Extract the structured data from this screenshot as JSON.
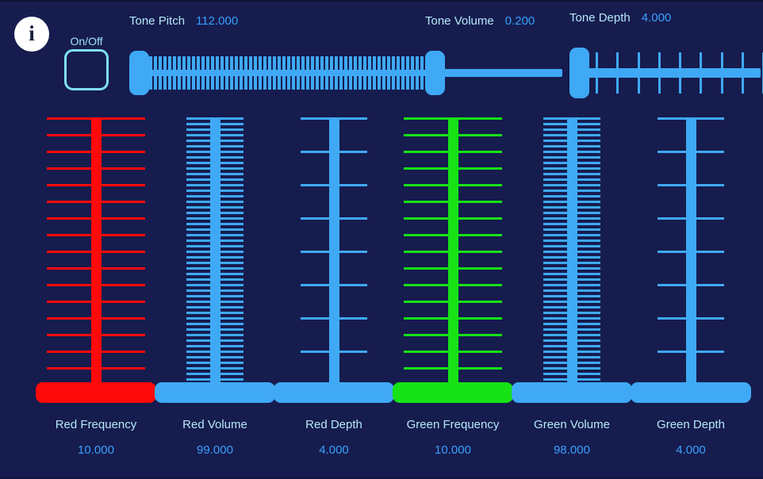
{
  "window": {
    "background_color": "#161c4e",
    "accent_color": "#3fa9f5",
    "label_color": "#b6e9f8",
    "value_color": "#3aa0ff"
  },
  "info_button": {
    "icon": "info-icon",
    "glyph": "i"
  },
  "onoff": {
    "label": "On/Off",
    "checked": false
  },
  "top_sliders": [
    {
      "id": "tone-pitch",
      "label": "Tone Pitch",
      "value": "112.000",
      "numeric": 112.0,
      "tick_style": "dense",
      "color": "#3fa9f5"
    },
    {
      "id": "tone-volume",
      "label": "Tone Volume",
      "value": "0.200",
      "numeric": 0.2,
      "tick_style": "none",
      "color": "#3fa9f5"
    },
    {
      "id": "tone-depth",
      "label": "Tone Depth",
      "value": "4.000",
      "numeric": 4.0,
      "tick_style": "sparse",
      "tick_count": 9,
      "color": "#3fa9f5"
    }
  ],
  "vertical_sliders": [
    {
      "id": "red-frequency",
      "label": "Red Frequency",
      "value": "10.000",
      "numeric": 10.0,
      "color": "#ff0a0a",
      "tick_count": 17,
      "tick_style": "medium",
      "tick_half_width": 62,
      "stem_width": 13
    },
    {
      "id": "red-volume",
      "label": "Red Volume",
      "value": "99.000",
      "numeric": 99.0,
      "color": "#3fa9f5",
      "tick_count": 99,
      "tick_style": "dense",
      "tick_half_width": 36,
      "stem_width": 13
    },
    {
      "id": "red-depth",
      "label": "Red Depth",
      "value": "4.000",
      "numeric": 4.0,
      "color": "#3fa9f5",
      "tick_count": 9,
      "tick_style": "sparse",
      "tick_half_width": 42,
      "stem_width": 13
    },
    {
      "id": "green-frequency",
      "label": "Green Frequency",
      "value": "10.000",
      "numeric": 10.0,
      "color": "#16e216",
      "tick_count": 17,
      "tick_style": "medium",
      "tick_half_width": 62,
      "stem_width": 13
    },
    {
      "id": "green-volume",
      "label": "Green Volume",
      "value": "98.000",
      "numeric": 98.0,
      "color": "#3fa9f5",
      "tick_count": 98,
      "tick_style": "dense",
      "tick_half_width": 36,
      "stem_width": 13
    },
    {
      "id": "green-depth",
      "label": "Green Depth",
      "value": "4.000",
      "numeric": 4.0,
      "color": "#3fa9f5",
      "tick_count": 9,
      "tick_style": "sparse",
      "tick_half_width": 42,
      "stem_width": 13
    }
  ]
}
